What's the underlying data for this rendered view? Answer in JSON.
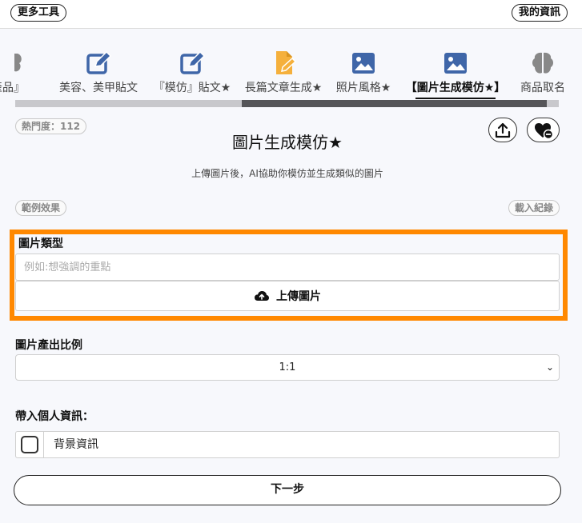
{
  "topbar": {
    "more_tools": "更多工具",
    "my_info": "我的資訊"
  },
  "tabs": [
    {
      "label": "產品』",
      "icon": "brain-icon"
    },
    {
      "label": "美容、美甲貼文",
      "icon": "edit-icon"
    },
    {
      "label": "『模仿』貼文★",
      "icon": "edit-icon"
    },
    {
      "label": "長篇文章生成★",
      "icon": "document-edit-icon"
    },
    {
      "label": "照片風格★",
      "icon": "image-icon"
    },
    {
      "label": "【圖片生成模仿★】",
      "icon": "image-icon",
      "active": true
    },
    {
      "label": "商品取名",
      "icon": "brain-icon"
    }
  ],
  "popularity": "熱門度：112",
  "page": {
    "title": "圖片生成模仿★",
    "subtitle": "上傳圖片後，AI協助你模仿並生成類似的圖片",
    "sample_label": "範例效果",
    "history_label": "載入紀錄"
  },
  "form": {
    "image_type_label": "圖片類型",
    "image_type_placeholder": "例如:想強調的重點",
    "upload_label": "上傳圖片",
    "ratio_label": "圖片產出比例",
    "ratio_value": "1:1",
    "personal_label": "帶入個人資訊：",
    "personal_option": "背景資訊",
    "next_label": "下一步"
  },
  "colors": {
    "highlight": "#ff8800",
    "icon_blue": "#3f66a8",
    "icon_orange": "#f5b03c",
    "icon_gray": "#888888"
  }
}
